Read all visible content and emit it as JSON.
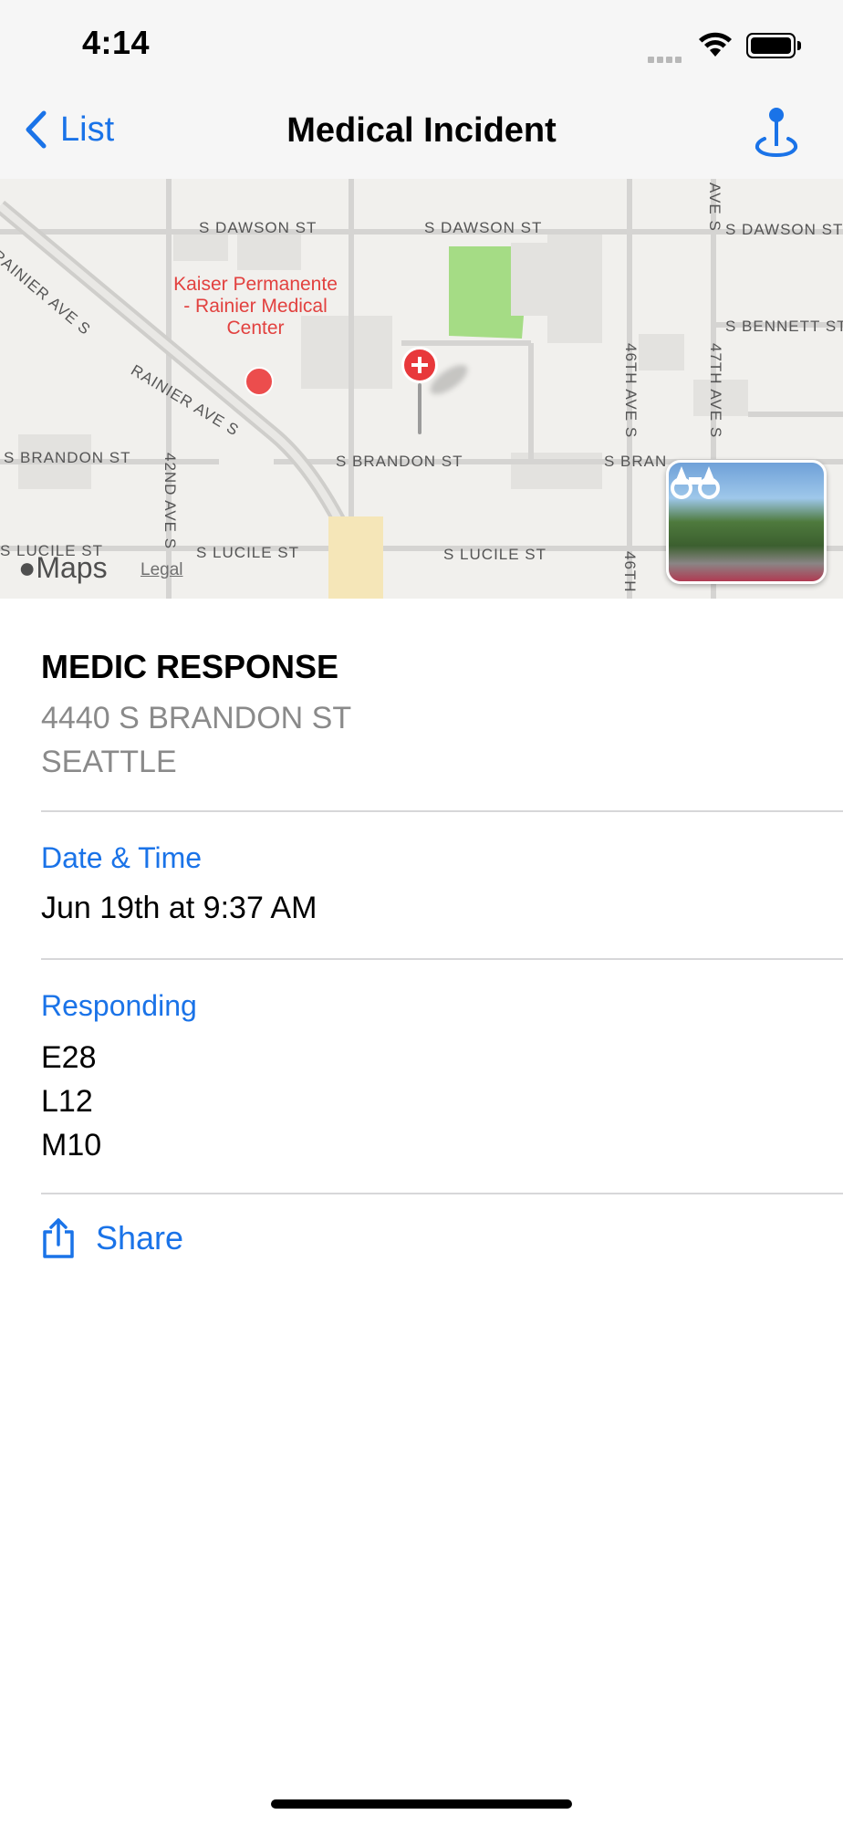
{
  "status_bar": {
    "time": "4:14"
  },
  "nav": {
    "back_label": "List",
    "title": "Medical Incident",
    "location_icon": "map-pin-icon"
  },
  "map": {
    "streets": {
      "dawson_left": "S DAWSON ST",
      "dawson_mid": "S DAWSON ST",
      "dawson_right": "S DAWSON ST",
      "bennett": "S BENNETT ST",
      "rainier_1": "RAINIER AVE S",
      "rainier_2": "RAINIER AVE S",
      "brandon_left": "S BRANDON ST",
      "brandon_mid": "S BRANDON ST",
      "brandon_right": "S BRAN",
      "lucile_left": "S LUCILE ST",
      "lucile_mid": "S LUCILE ST",
      "lucile_right": "S LUCILE ST",
      "ave42": "42ND AVE S",
      "ave46": "46TH AVE S",
      "ave47": "47TH AVE S",
      "ave46_bottom": "46TH",
      "ave_top": "AVE S"
    },
    "poi_name": "Kaiser Permanente - Rainier Medical Center",
    "brand": "Maps",
    "legal": "Legal"
  },
  "incident": {
    "type": "MEDIC RESPONSE",
    "address_line1": "4440 S BRANDON ST",
    "address_line2": "SEATTLE"
  },
  "datetime": {
    "label": "Date & Time",
    "value": "Jun 19th at 9:37 AM"
  },
  "responding": {
    "label": "Responding",
    "units": [
      "E28",
      "L12",
      "M10"
    ]
  },
  "share": {
    "label": "Share"
  },
  "colors": {
    "accent": "#1a73e8",
    "pin": "#e8383b",
    "poi": "#e2413f"
  }
}
